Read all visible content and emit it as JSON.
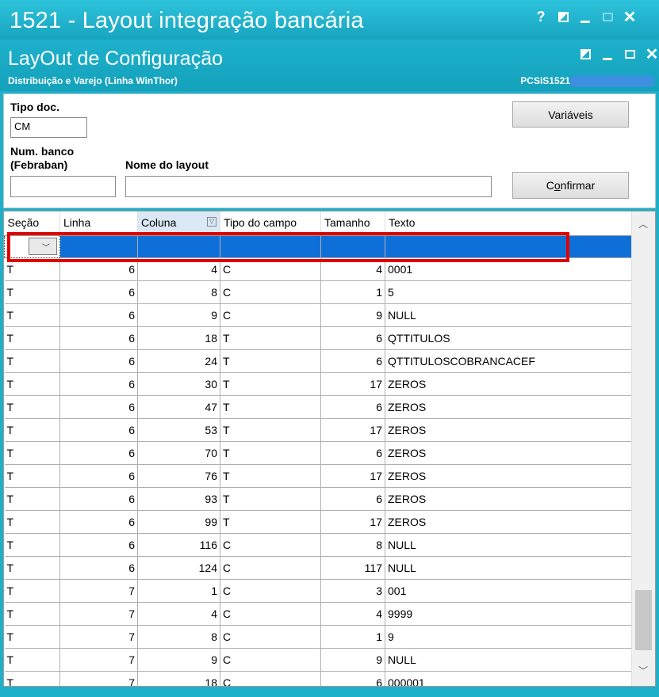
{
  "window": {
    "title": "1521 - Layout integração bancária",
    "buttons": {
      "help": "?",
      "close": "✕"
    }
  },
  "subwindow": {
    "title": "LayOut de Configuração",
    "subtitle": "Distribuição e Varejo (Linha WinThor)",
    "code": "PCSIS1521",
    "close": "✕"
  },
  "form": {
    "tipo_doc_label": "Tipo doc.",
    "tipo_doc_value": "CM",
    "num_banco_label_1": "Num. banco",
    "num_banco_label_2": "(Febraban)",
    "num_banco_value": "",
    "nome_layout_label": "Nome do layout",
    "nome_layout_value": "",
    "variaveis_button": "Variáveis",
    "confirmar_button_mnemonic": "o",
    "confirmar_button_pre": "C",
    "confirmar_button_post": "nfirmar"
  },
  "grid": {
    "columns": [
      "Seção",
      "Linha",
      "Coluna",
      "Tipo do campo",
      "Tamanho",
      "Texto"
    ],
    "rows": [
      [
        "T",
        "6",
        "4",
        "C",
        "4",
        "0001"
      ],
      [
        "T",
        "6",
        "8",
        "C",
        "1",
        "5"
      ],
      [
        "T",
        "6",
        "9",
        "C",
        "9",
        "NULL"
      ],
      [
        "T",
        "6",
        "18",
        "T",
        "6",
        "QTTITULOS"
      ],
      [
        "T",
        "6",
        "24",
        "T",
        "6",
        "QTTITULOSCOBRANCACEF"
      ],
      [
        "T",
        "6",
        "30",
        "T",
        "17",
        "ZEROS"
      ],
      [
        "T",
        "6",
        "47",
        "T",
        "6",
        "ZEROS"
      ],
      [
        "T",
        "6",
        "53",
        "T",
        "17",
        "ZEROS"
      ],
      [
        "T",
        "6",
        "70",
        "T",
        "6",
        "ZEROS"
      ],
      [
        "T",
        "6",
        "76",
        "T",
        "17",
        "ZEROS"
      ],
      [
        "T",
        "6",
        "93",
        "T",
        "6",
        "ZEROS"
      ],
      [
        "T",
        "6",
        "99",
        "T",
        "17",
        "ZEROS"
      ],
      [
        "T",
        "6",
        "116",
        "C",
        "8",
        "NULL"
      ],
      [
        "T",
        "6",
        "124",
        "C",
        "117",
        "NULL"
      ],
      [
        "T",
        "7",
        "1",
        "C",
        "3",
        "001"
      ],
      [
        "T",
        "7",
        "4",
        "C",
        "4",
        "9999"
      ],
      [
        "T",
        "7",
        "8",
        "C",
        "1",
        "9"
      ],
      [
        "T",
        "7",
        "9",
        "C",
        "9",
        "NULL"
      ],
      [
        "T",
        "7",
        "18",
        "C",
        "6",
        "000001"
      ]
    ]
  },
  "colors": {
    "titlebar": "#1fb0c9",
    "selection": "#0f6fd8",
    "highlight": "#e00000"
  }
}
